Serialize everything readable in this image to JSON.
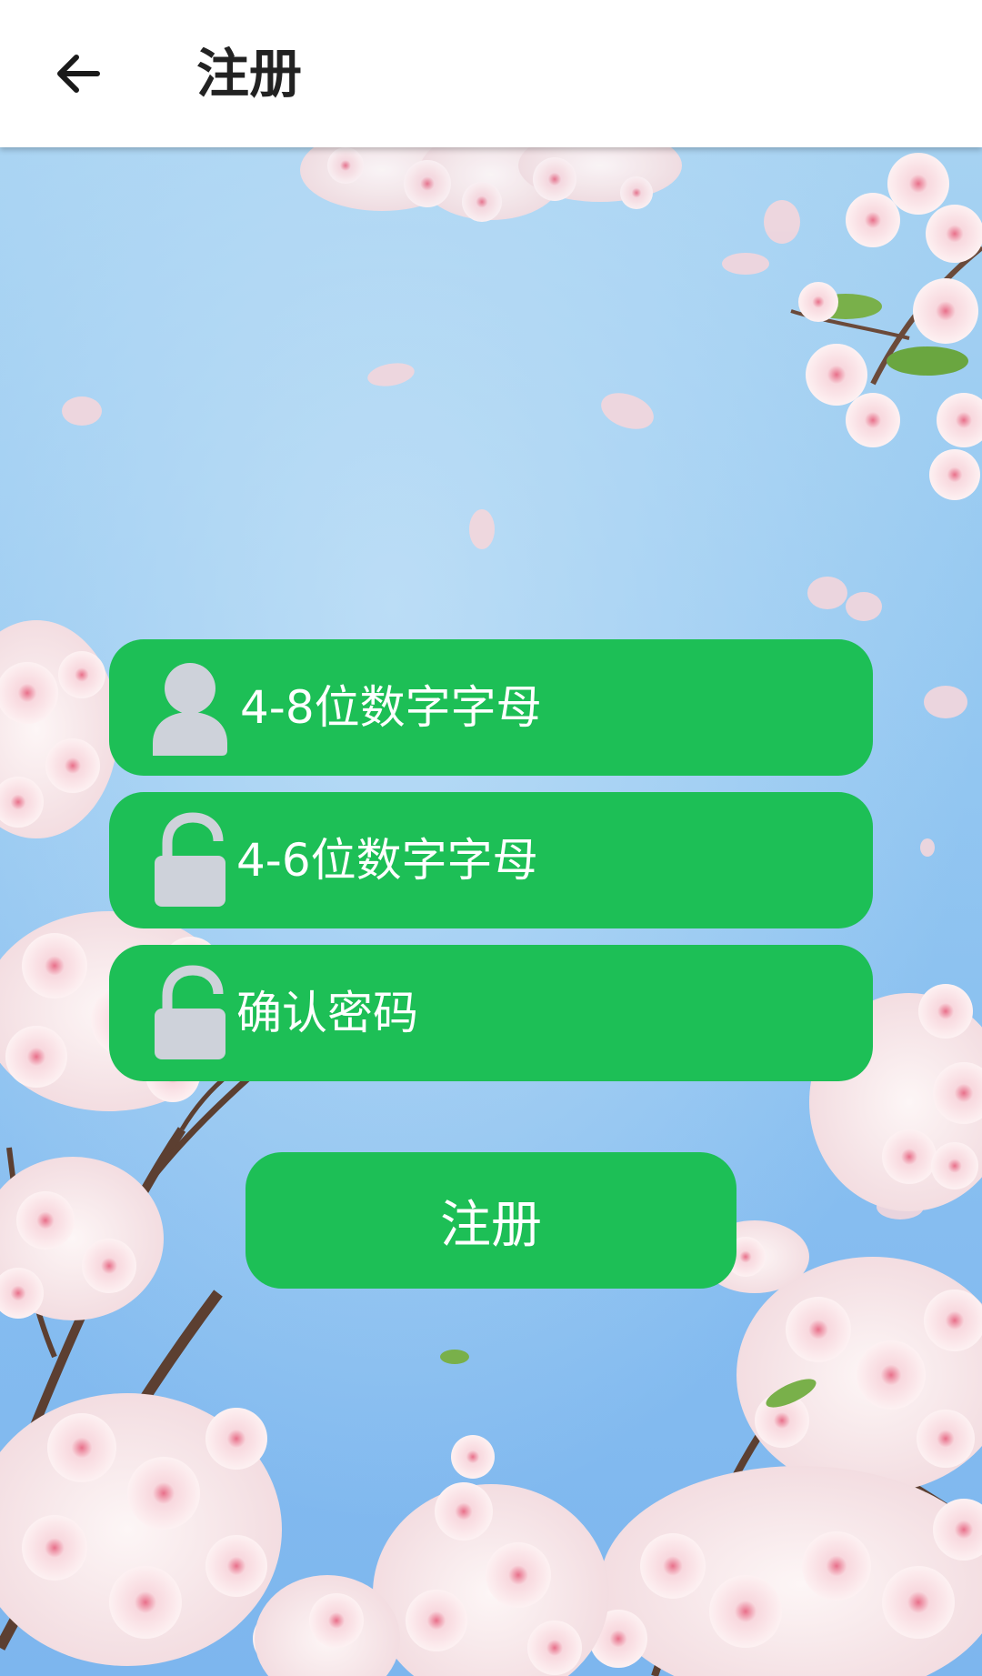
{
  "appbar": {
    "title": "注册",
    "back_icon": "arrow-left-icon"
  },
  "form": {
    "username": {
      "placeholder": "4-8位数字字母",
      "icon": "user-icon"
    },
    "password": {
      "placeholder": "4-6位数字字母",
      "icon": "unlock-icon"
    },
    "confirm": {
      "placeholder": "确认密码",
      "icon": "unlock-icon"
    }
  },
  "actions": {
    "register_label": "注册"
  },
  "colors": {
    "accent": "#1dbf56",
    "icon_gray": "#ced2da",
    "sky": "#8fc3f0",
    "appbar_bg": "#ffffff",
    "title_text": "#222222"
  }
}
